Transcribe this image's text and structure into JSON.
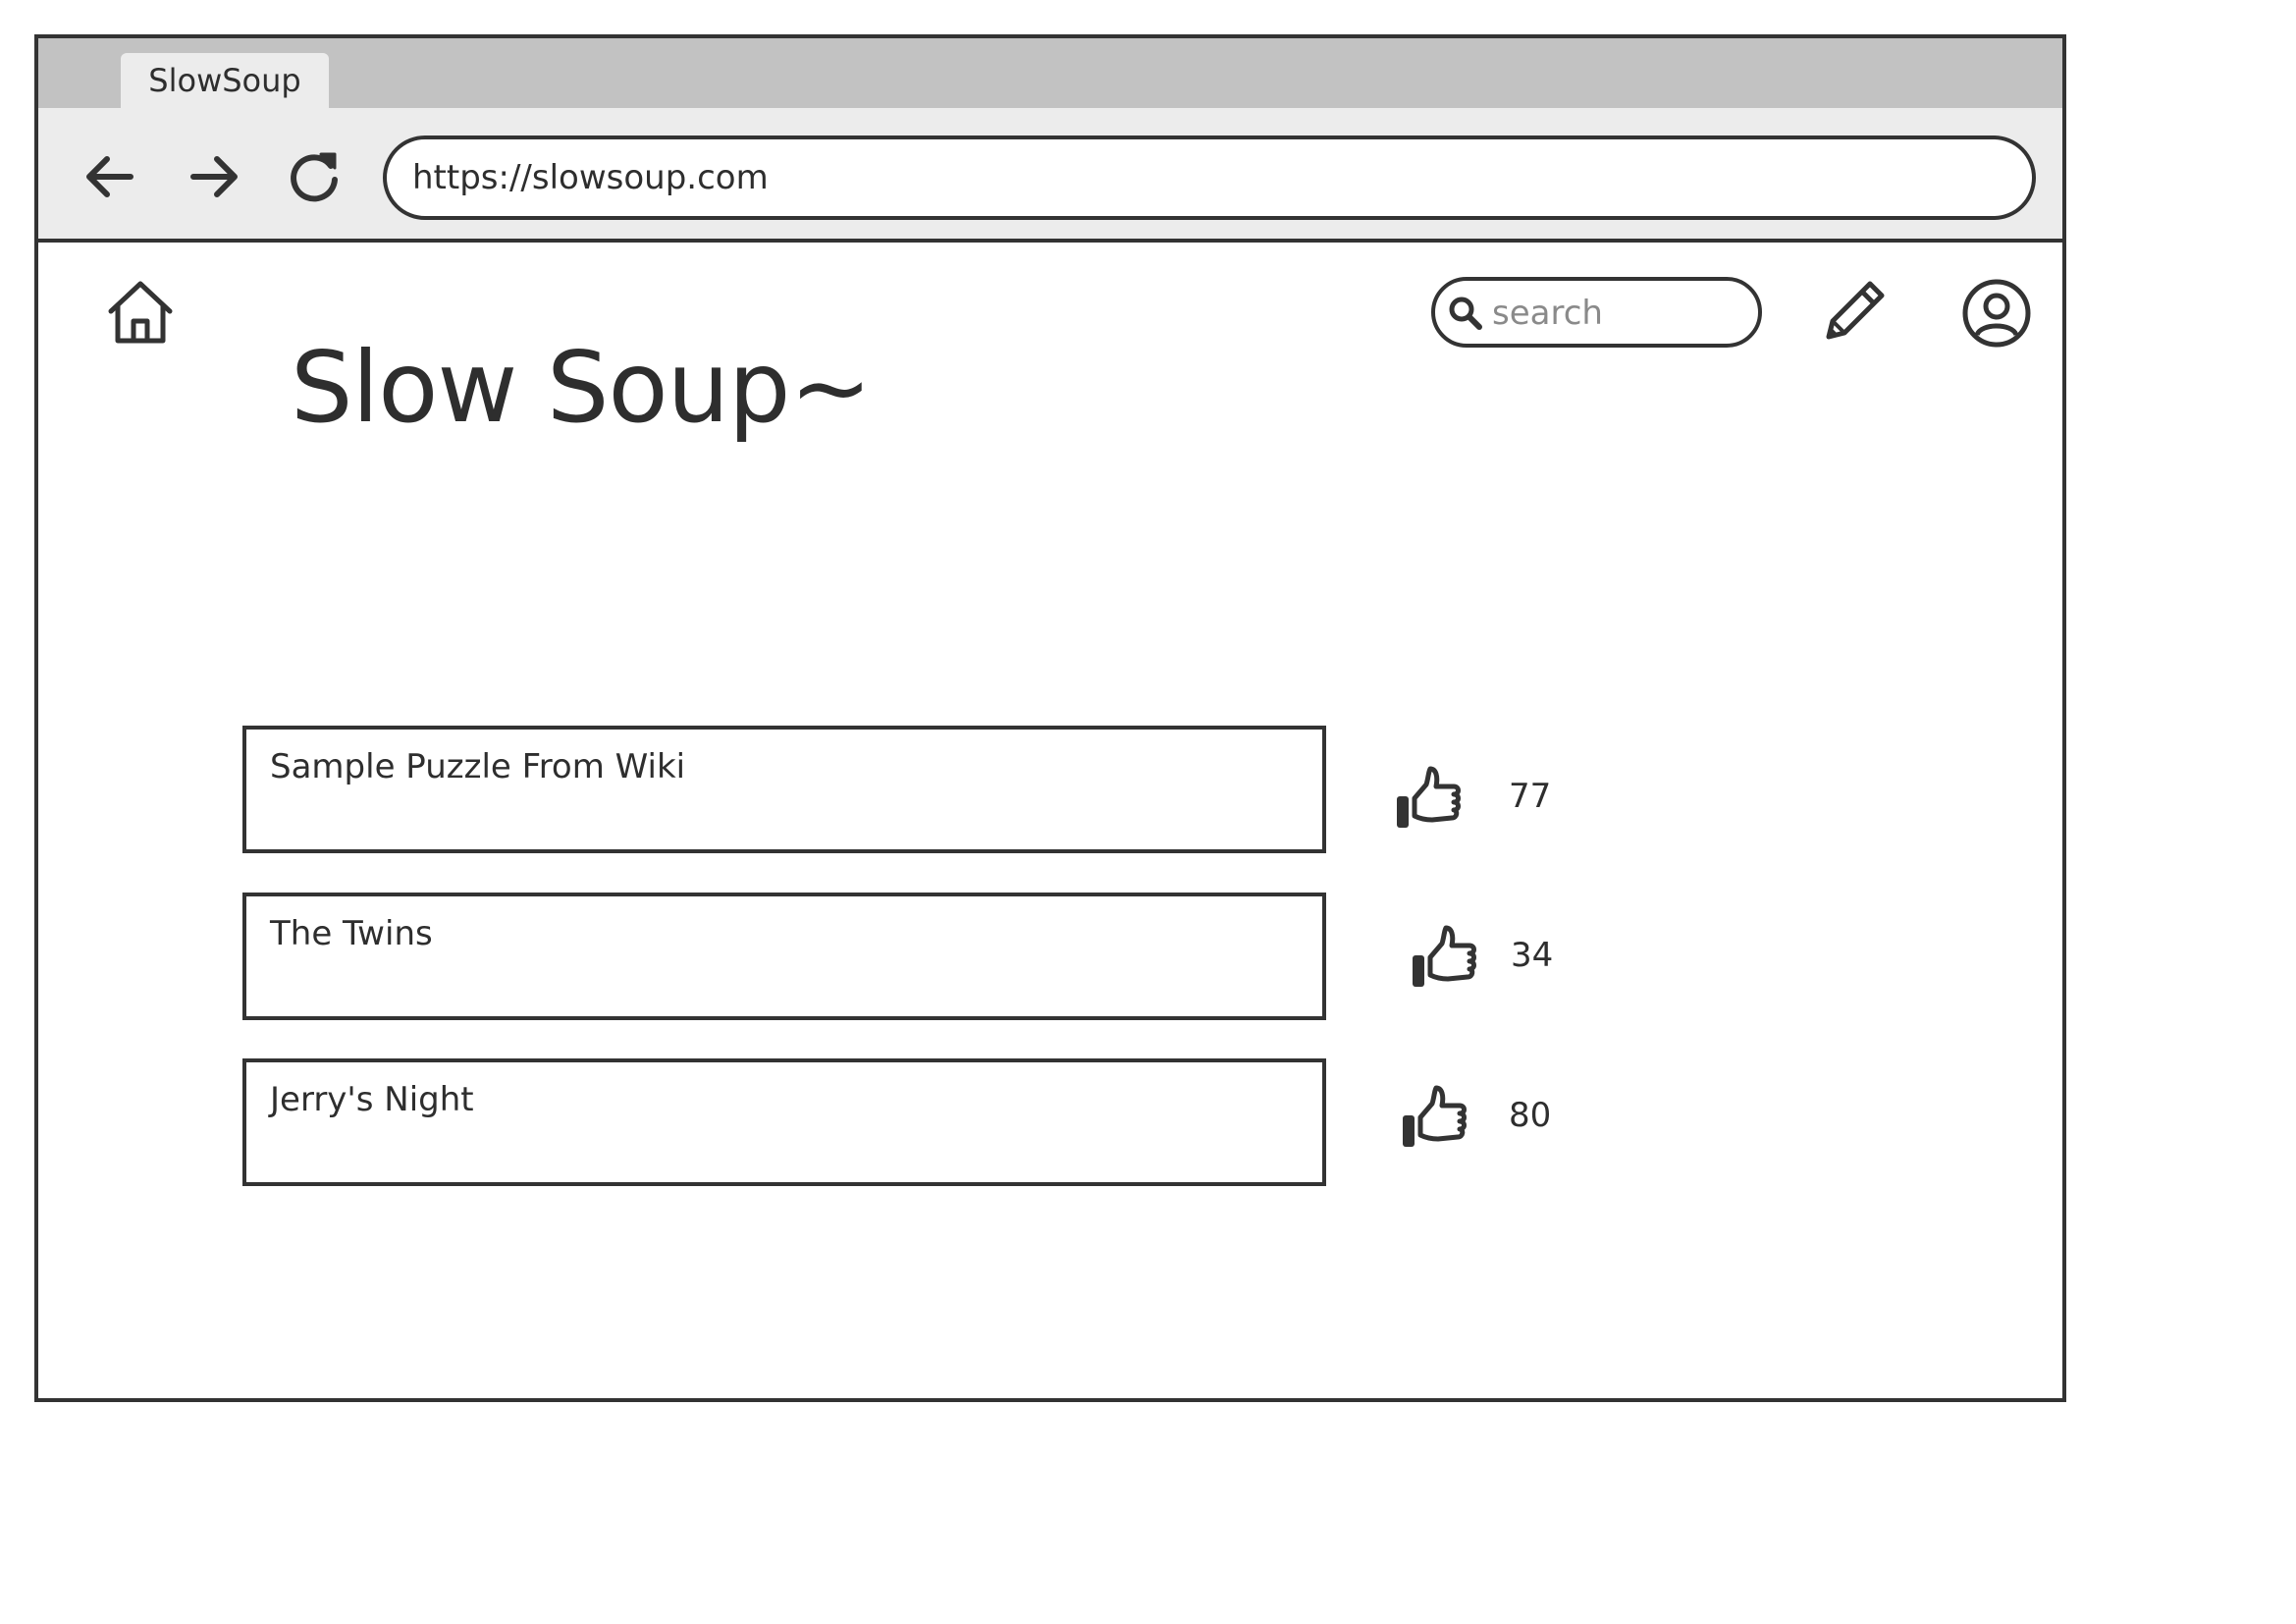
{
  "browser": {
    "tab_title": "SlowSoup",
    "url": "https://slowsoup.com",
    "back_icon": "arrow-left-icon",
    "forward_icon": "arrow-right-icon",
    "reload_icon": "reload-icon"
  },
  "header": {
    "home_icon": "home-icon",
    "search_placeholder": "search",
    "search_value": "",
    "edit_icon": "pencil-icon",
    "account_icon": "user-circle-icon"
  },
  "main": {
    "title": "Slow Soup~",
    "puzzles": [
      {
        "title": "Sample Puzzle From Wiki",
        "likes": "77"
      },
      {
        "title": "The Twins",
        "likes": "34"
      },
      {
        "title": "Jerry's Night",
        "likes": "80"
      }
    ],
    "like_icon": "thumbs-up-icon"
  },
  "colors": {
    "ink": "#333333",
    "tabstrip": "#c2c2c2",
    "toolbar": "#ececec",
    "placeholder": "#8a8a8a"
  }
}
